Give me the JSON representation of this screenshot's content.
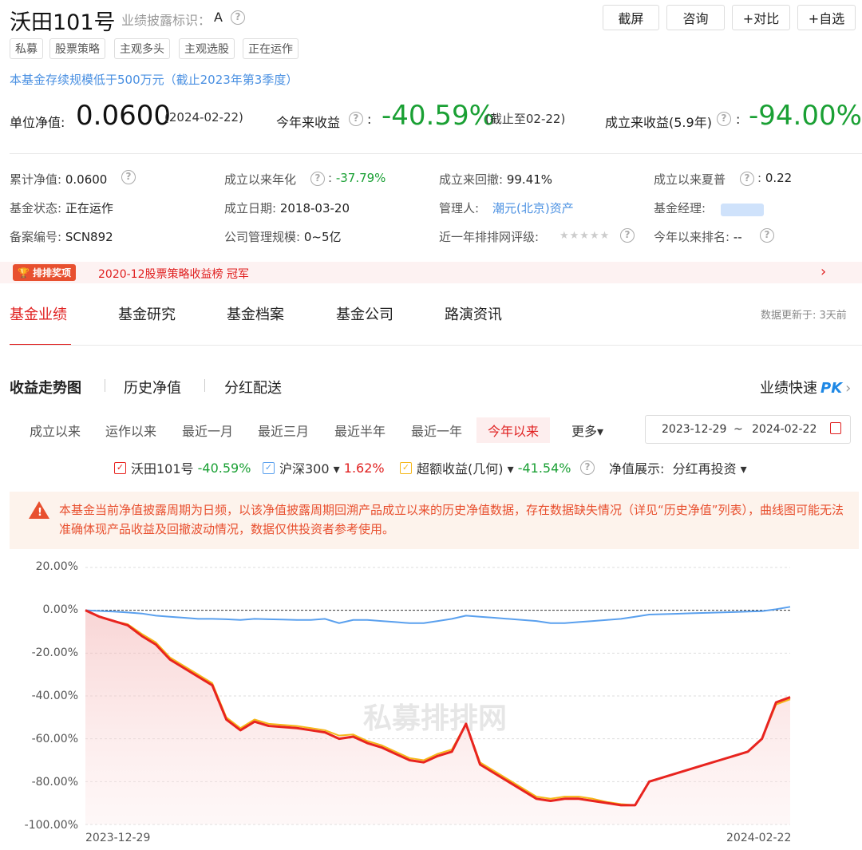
{
  "header": {
    "fund_name": "沃田101号",
    "disclosure_label": "业绩披露标识：",
    "disclosure_value": "A",
    "buttons": [
      "截屏",
      "咨询",
      "+对比",
      "+自选"
    ],
    "tags": [
      "私募",
      "股票策略",
      "主观多头",
      "主观选股",
      "正在运作"
    ],
    "notice": "本基金存续规模低于500万元（截止2023年第3季度）"
  },
  "nav": {
    "unit_nav_label": "单位净值:",
    "unit_nav_value": "0.0600",
    "unit_nav_date": "(2024-02-22)",
    "ytd_label": "今年来收益",
    "ytd_value": "-40.59%",
    "ytd_note": "(截止至02-22)",
    "since_label": "成立来收益(5.9年)",
    "since_value": "-94.00%"
  },
  "info": {
    "row1": [
      {
        "label": "累计净值:",
        "value": "0.0600"
      },
      {
        "label": "成立以来年化",
        "value": "-37.79%"
      },
      {
        "label": "成立来回撤:",
        "value": "99.41%"
      },
      {
        "label": "成立以来夏普",
        "value": "0.22"
      }
    ],
    "row2": [
      {
        "label": "基金状态:",
        "value": "正在运作"
      },
      {
        "label": "成立日期:",
        "value": "2018-03-20"
      },
      {
        "label": "管理人:",
        "value": "潮元(北京)资产"
      },
      {
        "label": "基金经理:",
        "value": ""
      }
    ],
    "row3": [
      {
        "label": "备案编号:",
        "value": "SCN892"
      },
      {
        "label": "公司管理规模:",
        "value": "0~5亿"
      },
      {
        "label": "近一年排排网评级:",
        "value": "★★★★★"
      },
      {
        "label": "今年以来排名:",
        "value": "--"
      }
    ]
  },
  "award": {
    "badge": "排排奖项",
    "text": "2020-12股票策略收益榜 冠军"
  },
  "tabs": [
    "基金业绩",
    "基金研究",
    "基金档案",
    "基金公司",
    "路演资讯"
  ],
  "update_note": "数据更新于: 3天前",
  "subtabs": [
    "收益走势图",
    "历史净值",
    "分红配送"
  ],
  "pk_label": "业绩快速",
  "pk_brand": "PK",
  "periods": [
    "成立以来",
    "运作以来",
    "最近一月",
    "最近三月",
    "最近半年",
    "最近一年",
    "今年以来",
    "更多▾"
  ],
  "date_range": {
    "start": "2023-12-29",
    "sep": "~",
    "end": "2024-02-22"
  },
  "legend": [
    {
      "name": "沃田101号",
      "value": "-40.59%"
    },
    {
      "name": "沪深300 ▾",
      "value": "1.62%"
    },
    {
      "name": "超额收益(几何) ▾",
      "value": "-41.54%"
    }
  ],
  "nav_display": {
    "label": "净值展示:",
    "value": "分红再投资 ▾"
  },
  "warning": "本基金当前净值披露周期为日频，以该净值披露周期回溯产品成立以来的历史净值数据，存在数据缺失情况（详见“历史净值”列表），曲线图可能无法准确体现产品收益及回撤波动情况，数据仅供投资者参考使用。",
  "watermark": "私募排排网",
  "colors": {
    "fund": "#e8241f",
    "index": "#5aa0ee",
    "excess": "#f5b719",
    "accent": "#e02020",
    "green": "#1aa034"
  },
  "chart_data": {
    "type": "line",
    "yticks": [
      "20.00%",
      "0.00%",
      "-20.00%",
      "-40.00%",
      "-60.00%",
      "-80.00%",
      "-100.00%"
    ],
    "ylim": [
      -100,
      20
    ],
    "xlabels": [
      "2023-12-29",
      "2024-02-22"
    ],
    "x": [
      0,
      1,
      2,
      3,
      4,
      5,
      6,
      7,
      8,
      9,
      10,
      11,
      12,
      13,
      14,
      15,
      16,
      17,
      18,
      19,
      20,
      21,
      22,
      23,
      24,
      25,
      26,
      27,
      28,
      29,
      30,
      31,
      32,
      33,
      34,
      35,
      36,
      37,
      38,
      39,
      40,
      41,
      42,
      43,
      44,
      45,
      46,
      47,
      48,
      49,
      50
    ],
    "series": [
      {
        "name": "沃田101号",
        "values": [
          0,
          -3,
          -5,
          -7,
          -12,
          -16,
          -23,
          -27,
          -31,
          -35,
          -51,
          -56,
          -52,
          -54,
          -54.5,
          -55,
          -56,
          -57,
          -60,
          -59,
          -62,
          -64,
          -67,
          -70,
          -71,
          -68,
          -66,
          -53,
          -72,
          -76,
          -80,
          -84,
          -88,
          -89,
          -88,
          -88,
          -89,
          -90,
          -91,
          -91,
          -80,
          -78,
          -76,
          -74,
          -72,
          -70,
          -68,
          -66,
          -60,
          -43,
          -40.59
        ]
      },
      {
        "name": "沪深300",
        "values": [
          0,
          -0.3,
          -0.6,
          -1,
          -1.5,
          -2.5,
          -3,
          -3.5,
          -4,
          -4,
          -4.2,
          -4.5,
          -4,
          -4.2,
          -4.3,
          -4.5,
          -4.5,
          -4,
          -6,
          -4.5,
          -4.5,
          -5,
          -5.5,
          -6,
          -6,
          -5,
          -4,
          -2.5,
          -3,
          -3.5,
          -4,
          -4.5,
          -5,
          -6,
          -6,
          -5.5,
          -5,
          -4.5,
          -4,
          -3,
          -2,
          -1.8,
          -1.6,
          -1.4,
          -1.2,
          -1,
          -0.8,
          -0.6,
          -0.4,
          0.5,
          1.62
        ]
      },
      {
        "name": "超额收益(几何)",
        "values": [
          0,
          -3,
          -5,
          -6.5,
          -11,
          -15,
          -22,
          -26,
          -30,
          -34,
          -50,
          -55,
          -51,
          -53,
          -53.5,
          -54,
          -55,
          -56,
          -58.5,
          -58,
          -61,
          -63,
          -66,
          -69,
          -70,
          -67,
          -65,
          -53,
          -71,
          -75,
          -79,
          -83,
          -87,
          -88,
          -87,
          -87,
          -88,
          -89.5,
          -90.5,
          -91,
          -80,
          -78,
          -76,
          -74,
          -72,
          -70,
          -68,
          -66,
          -60,
          -44,
          -41.54
        ]
      }
    ]
  }
}
